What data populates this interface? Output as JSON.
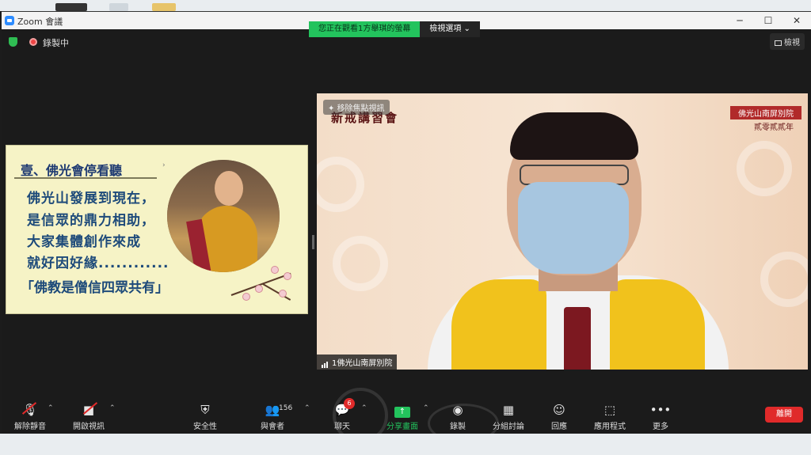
{
  "window": {
    "title": "Zoom 會議"
  },
  "share_banner": {
    "status": "您正在觀看1方舉琪的螢幕",
    "view_options": "檢視選項"
  },
  "status": {
    "recording": "錄製中",
    "view": "檢視"
  },
  "slide": {
    "heading": "壹、佛光會停看聽",
    "lines": [
      "佛光山發展到現在，",
      "是信眾的鼎力相助，",
      "大家集體創作來成",
      "就好因好緣............"
    ],
    "quote": "「佛教是僧信四眾共有」"
  },
  "camera": {
    "unfocus_label": "移除焦點視訊",
    "banner_left": "新戒講習會",
    "banner_right": "佛光山南屏別院",
    "banner_right_sub": "貳零貳貳年",
    "participant": "1佛光山南屏別院"
  },
  "toolbar": {
    "mute": "解除靜音",
    "video": "開啟視訊",
    "security": "安全性",
    "participants": "與會者",
    "participants_count": "156",
    "chat": "聊天",
    "chat_badge": "6",
    "share": "分享畫面",
    "record": "錄製",
    "breakout": "分組討論",
    "reactions": "回應",
    "apps": "應用程式",
    "more": "更多",
    "leave": "離開"
  },
  "colors": {
    "accent_green": "#23c35d",
    "leave_red": "#e02a2a",
    "slide_bg": "#f6f3c6"
  }
}
